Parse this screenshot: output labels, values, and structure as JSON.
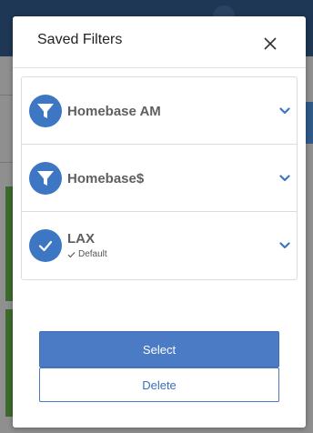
{
  "modal": {
    "title": "Saved Filters",
    "close_icon": "close-icon"
  },
  "filters": [
    {
      "label": "Homebase AM",
      "icon": "filter-icon",
      "sub": ""
    },
    {
      "label": "Homebase$",
      "icon": "filter-icon",
      "sub": ""
    },
    {
      "label": "LAX",
      "icon": "check-icon",
      "sub": "Default"
    }
  ],
  "actions": {
    "select_label": "Select",
    "delete_label": "Delete"
  },
  "colors": {
    "accent": "#4a7bc4",
    "icon_bg": "#3d76c2",
    "header_bg": "#1e3754"
  }
}
